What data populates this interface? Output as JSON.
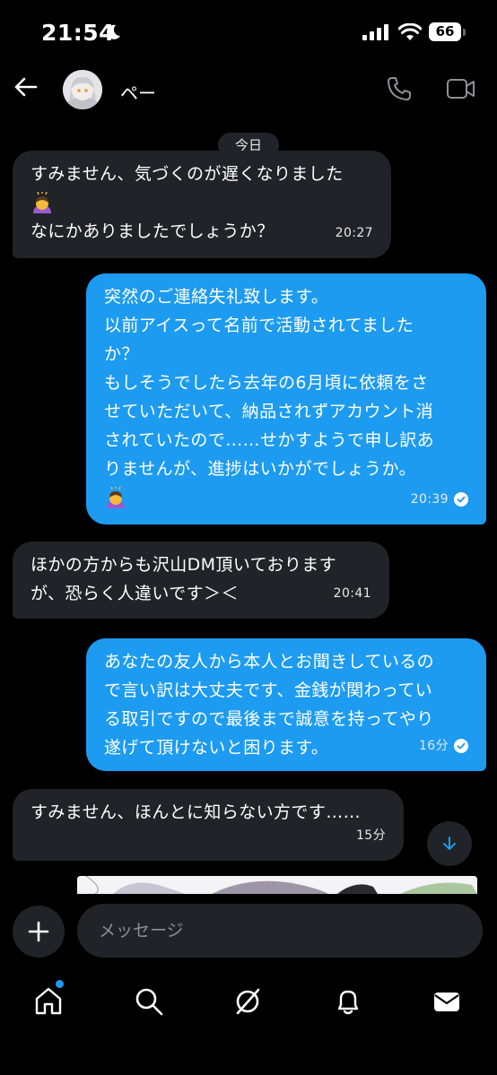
{
  "status_bar": {
    "time": "21:54",
    "battery": "66"
  },
  "header": {
    "contact_name": "ペー"
  },
  "date_chip": "今日",
  "messages": [
    {
      "lines": [
        "すみません、気づくのが遅くなりました",
        "",
        "なにかありましたでしょうか？"
      ],
      "time": "20:27"
    },
    {
      "lines": [
        "突然のご連絡失礼致します。",
        "以前アイスって名前で活動されてました",
        "か？",
        "もしそうでしたら去年の6月頃に依頼をさ",
        "せていただいて、納品されずアカウント消",
        "されていたので……せかすようで申し訳あ",
        "りませんが、進捗はいかがでしょうか。",
        ""
      ],
      "time": "20:39"
    },
    {
      "lines": [
        "ほかの方からも沢山DM頂いております",
        "が、恐らく人違いです＞＜"
      ],
      "time": "20:41"
    },
    {
      "lines": [
        "あなたの友人から本人とお聞きしているの",
        "で言い訳は大丈夫です、金銭が関わってい",
        "る取引ですので最後まで誠意を持ってやり",
        "遂げて頂けないと困ります。"
      ],
      "time": "16分"
    },
    {
      "lines": [
        "すみません、ほんとに知らない方です……"
      ],
      "time": "15分"
    }
  ],
  "composer": {
    "placeholder": "メッセージ"
  },
  "colors": {
    "accent": "#1d9bf0",
    "incoming_bubble": "#202327",
    "background": "#000000"
  },
  "icons": [
    "moon-icon",
    "signal-icon",
    "wifi-icon",
    "back-arrow-icon",
    "phone-icon",
    "video-icon",
    "read-check-icon",
    "arrow-down-icon",
    "plus-icon",
    "home-icon",
    "search-icon",
    "grok-icon",
    "bell-icon",
    "mail-icon"
  ]
}
